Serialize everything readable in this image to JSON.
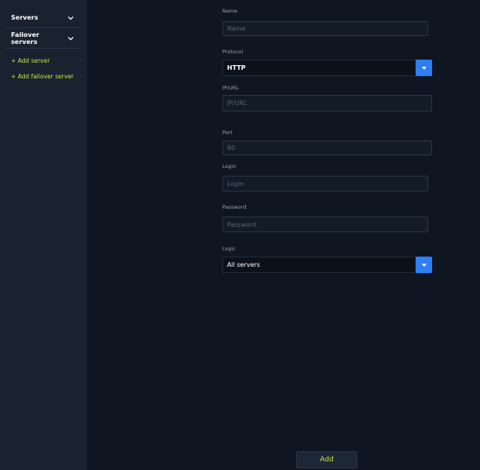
{
  "sidebar": {
    "sections": [
      {
        "label": "Servers",
        "icon": "chevron-down-icon"
      },
      {
        "label": "Failover servers",
        "icon": "chevron-down-icon"
      }
    ],
    "links": [
      {
        "label": "+ Add server",
        "icon": "chevron-right-icon"
      },
      {
        "label": "+ Add failover server",
        "icon": "chevron-right-icon"
      }
    ]
  },
  "form": {
    "name": {
      "label": "Name",
      "placeholder": "Name"
    },
    "protocol": {
      "label": "Protocol",
      "selected": "HTTP"
    },
    "ip_url": {
      "label": "IP/URL",
      "placeholder": "IP/URL"
    },
    "port": {
      "label": "Port",
      "placeholder": "80"
    },
    "login": {
      "label": "Login",
      "placeholder": "Login"
    },
    "password": {
      "label": "Password",
      "placeholder": "Password"
    },
    "logic": {
      "label": "Logic",
      "selected": "All servers"
    },
    "submit_label": "Add"
  },
  "colors": {
    "background": "#0f1622",
    "sidebar": "#1a2230",
    "accent_green": "#c6e34a",
    "accent_blue": "#2f7ef6"
  }
}
